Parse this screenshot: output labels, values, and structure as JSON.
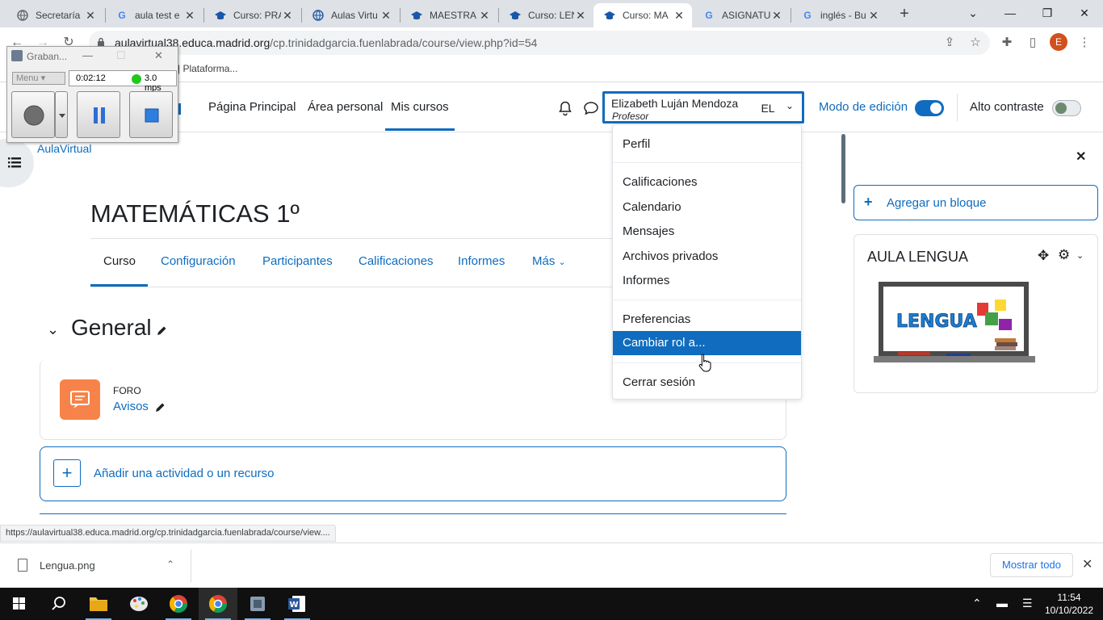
{
  "browser": {
    "tabs": [
      {
        "title": "Secretaría",
        "icon": "globe-icon",
        "close": "✕"
      },
      {
        "title": "aula test e",
        "icon": "google-icon",
        "close": "✕"
      },
      {
        "title": "Curso: PRA",
        "icon": "moodle-cap-icon",
        "close": "✕"
      },
      {
        "title": "Aulas Virtu",
        "icon": "globe-icon",
        "close": "✕"
      },
      {
        "title": "MAESTRA",
        "icon": "moodle-cap-icon",
        "close": "✕"
      },
      {
        "title": "Curso: LEN",
        "icon": "moodle-cap-icon",
        "close": "✕"
      },
      {
        "title": "Curso: MA",
        "icon": "moodle-cap-icon",
        "close": "✕",
        "active": true
      },
      {
        "title": "ASIGNATU",
        "icon": "google-icon",
        "close": "✕"
      },
      {
        "title": "inglés - Bu",
        "icon": "google-icon",
        "close": "✕"
      }
    ],
    "new_tab": "+",
    "window_controls": {
      "dropdown": "⌄",
      "minimize": "—",
      "restore": "❐",
      "close": "✕"
    },
    "url_host": "aulavirtual38.educa.madrid.org",
    "url_path": "/cp.trinidadgarcia.fuenlabrada/course/view.php?id=54",
    "profile_initial": "E",
    "bookmark": "| Plataforma..."
  },
  "recorder": {
    "title": "Graban...",
    "menu": "Menu",
    "time": "0:02:12",
    "rate": "3.0 mps"
  },
  "navbar": {
    "links": [
      "Página Principal",
      "Área personal",
      "Mis cursos"
    ],
    "user_name": "Elizabeth Luján Mendoza",
    "user_role": "Profesor",
    "user_initials": "EL",
    "edit_mode_label": "Modo de edición",
    "high_contrast_label": "Alto contraste",
    "edit_mode_on": true,
    "high_contrast_on": false
  },
  "breadcrumb": "AulaVirtual",
  "course": {
    "title": "MATEMÁTICAS 1º",
    "tabs": [
      "Curso",
      "Configuración",
      "Participantes",
      "Calificaciones",
      "Informes",
      "Más"
    ],
    "section_title": "General",
    "activity_type": "FORO",
    "activity_name": "Avisos",
    "add_activity": "Añadir una actividad o un recurso"
  },
  "user_dropdown": {
    "items_group1": [
      "Perfil"
    ],
    "items_group2": [
      "Calificaciones",
      "Calendario",
      "Mensajes",
      "Archivos privados",
      "Informes"
    ],
    "items_group3": [
      "Preferencias",
      "Cambiar rol a..."
    ],
    "items_group4": [
      "Cerrar sesión"
    ],
    "highlighted": "Cambiar rol a..."
  },
  "blocks": {
    "add_block": "Agregar un bloque",
    "block_title": "AULA LENGUA",
    "board_word": "LENGUA"
  },
  "status_url": "https://aulavirtual38.educa.madrid.org/cp.trinidadgarcia.fuenlabrada/course/view....",
  "downloads": {
    "file": "Lengua.png",
    "show_all": "Mostrar todo"
  },
  "taskbar": {
    "time": "11:54",
    "date": "10/10/2022"
  },
  "colors": {
    "accent": "#0f6cbf",
    "forum_orange": "#f7834a",
    "chrome_tabstrip": "#dee1e6"
  }
}
